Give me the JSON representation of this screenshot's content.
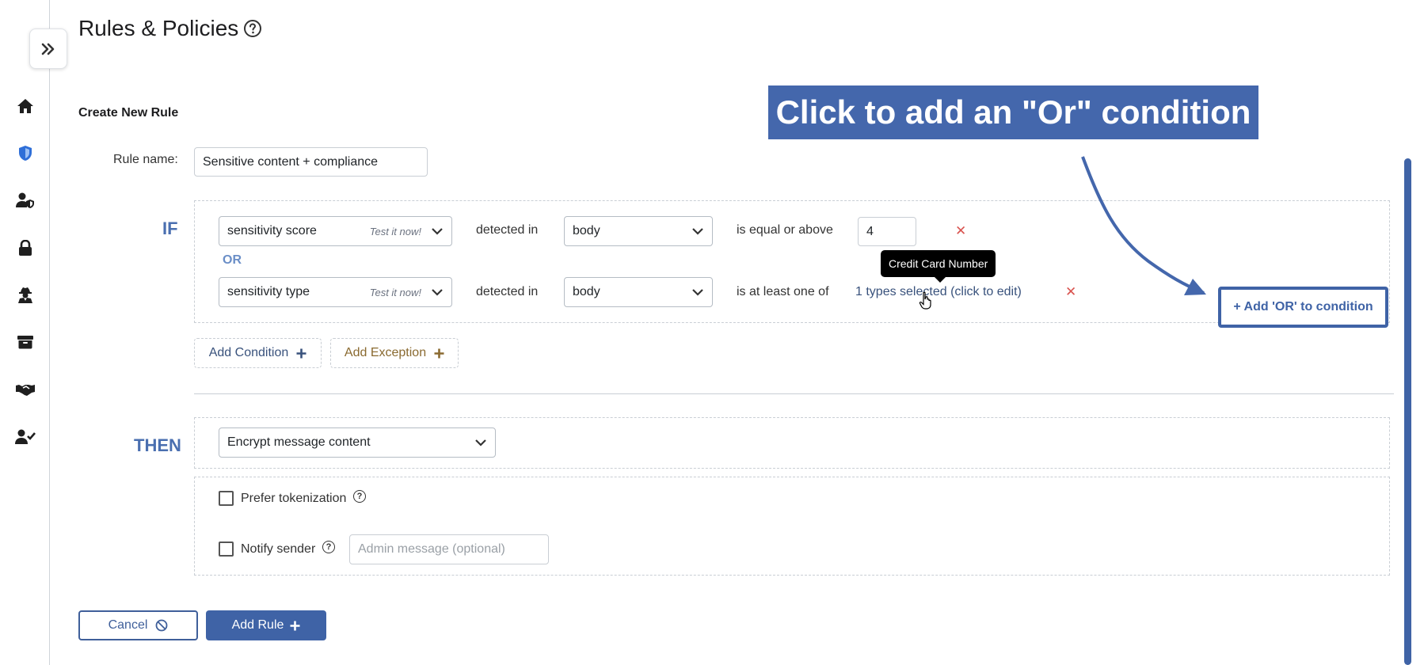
{
  "page": {
    "title": "Rules & Policies",
    "help_icon": "question-circle-icon"
  },
  "sidebar": {
    "toggle_icon": "double-chevron-right-icon",
    "items": [
      {
        "icon": "home-icon"
      },
      {
        "icon": "shield-icon"
      },
      {
        "icon": "user-shield-icon"
      },
      {
        "icon": "lock-icon"
      },
      {
        "icon": "user-secret-icon"
      },
      {
        "icon": "archive-icon"
      },
      {
        "icon": "handshake-icon"
      },
      {
        "icon": "user-check-icon"
      }
    ]
  },
  "form": {
    "section_title": "Create New Rule",
    "rule_name_label": "Rule name:",
    "rule_name_value": "Sensitive content + compliance",
    "if_label": "IF",
    "or_label": "OR",
    "conditions": [
      {
        "field": "sensitivity score",
        "test_label": "Test it now!",
        "detected_in_label": "detected in",
        "location": "body",
        "operator": "is equal or above",
        "value": "4"
      },
      {
        "field": "sensitivity type",
        "test_label": "Test it now!",
        "detected_in_label": "detected in",
        "location": "body",
        "operator": "is at least one of",
        "value_link": "1 types selected (click to edit)"
      }
    ],
    "tooltip": "Credit Card Number",
    "add_condition_label": "Add Condition",
    "add_exception_label": "Add Exception",
    "then_label": "THEN",
    "action": "Encrypt message content",
    "prefer_tokenization_label": "Prefer tokenization",
    "notify_sender_label": "Notify sender",
    "admin_message_placeholder": "Admin message (optional)",
    "cancel_label": "Cancel",
    "add_rule_label": "Add Rule"
  },
  "annotation": {
    "callout_text": "Click to add an \"Or\" condition",
    "button_label": "+ Add 'OR' to condition"
  },
  "colors": {
    "primary": "#3f63a6",
    "callout_bg": "#4467ac",
    "exception": "#8a6a30",
    "remove": "#d9534f"
  }
}
